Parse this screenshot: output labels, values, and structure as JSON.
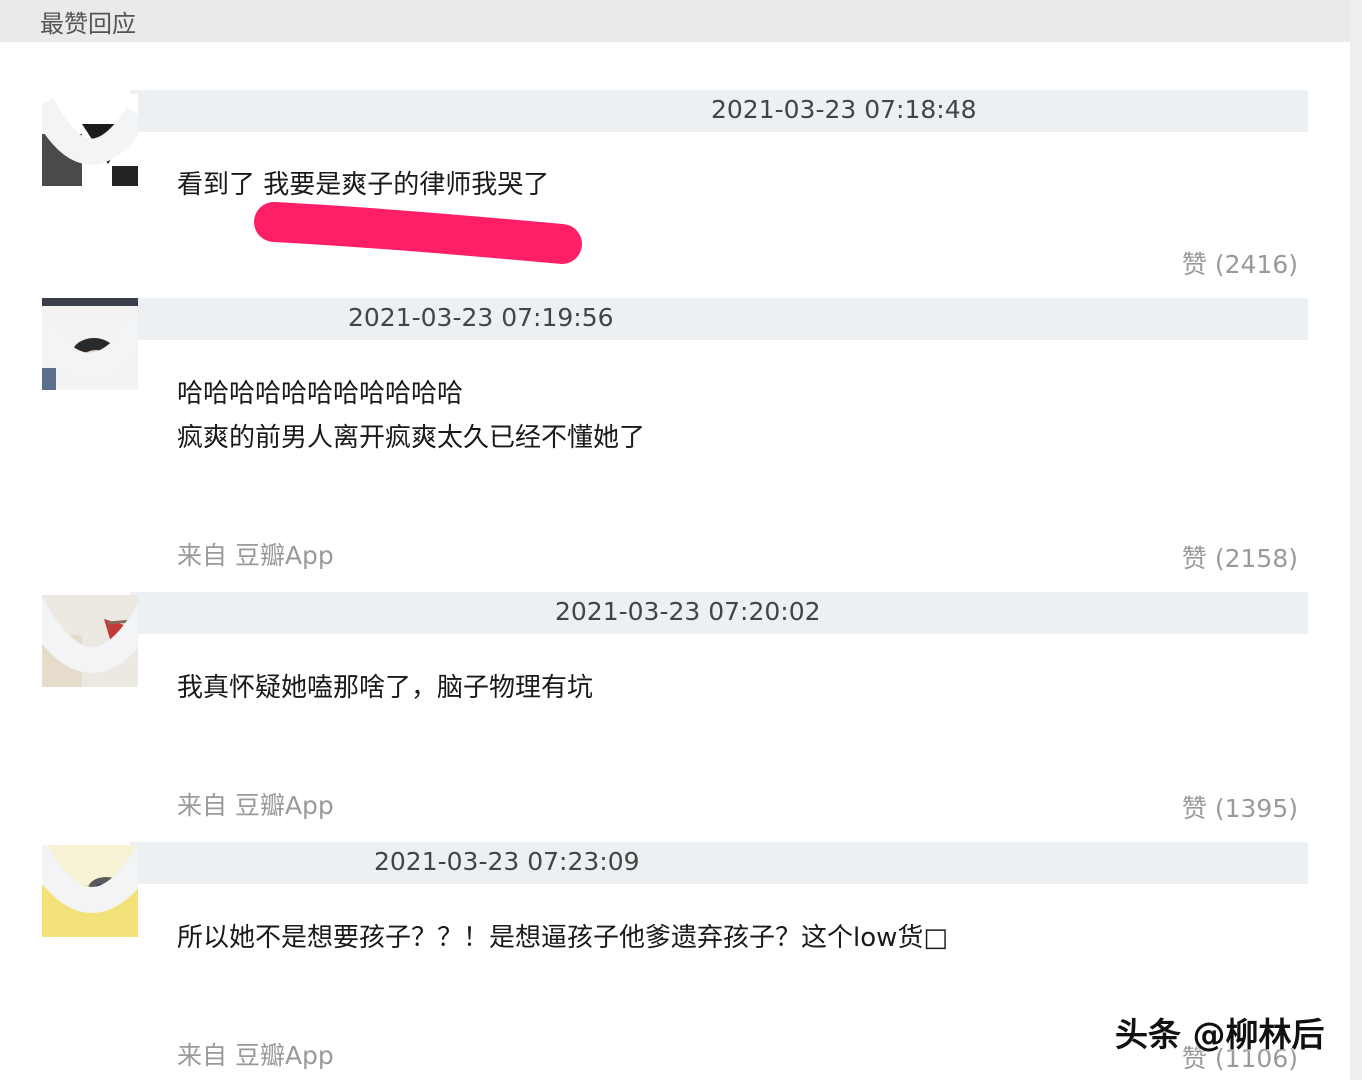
{
  "section": {
    "title": "最赞回应"
  },
  "comments": [
    {
      "timestamp": "2021-03-23 07:18:48",
      "lines": [
        "看到了 我要是爽子的律师我哭了"
      ],
      "source": "",
      "likes": "赞 (2416)"
    },
    {
      "timestamp": "2021-03-23 07:19:56",
      "lines": [
        "哈哈哈哈哈哈哈哈哈哈哈",
        "疯爽的前男人离开疯爽太久已经不懂她了"
      ],
      "source": "来自 豆瓣App",
      "likes": "赞 (2158)"
    },
    {
      "timestamp": "2021-03-23 07:20:02",
      "lines": [
        "我真怀疑她嗑那啥了，脑子物理有坑"
      ],
      "source": "来自 豆瓣App",
      "likes": "赞 (1395)"
    },
    {
      "timestamp": "2021-03-23 07:23:09",
      "lines": [
        "所以她不是想要孩子？？！是想逼孩子他爹遗弃孩子？这个low货□"
      ],
      "source": "来自 豆瓣App",
      "likes": "赞 (1106)"
    }
  ],
  "watermark": "头条 @柳林后",
  "colors": {
    "highlight": "#ff1f66",
    "meta_bar": "#edf0f2",
    "muted_text": "#9a9a9a"
  }
}
